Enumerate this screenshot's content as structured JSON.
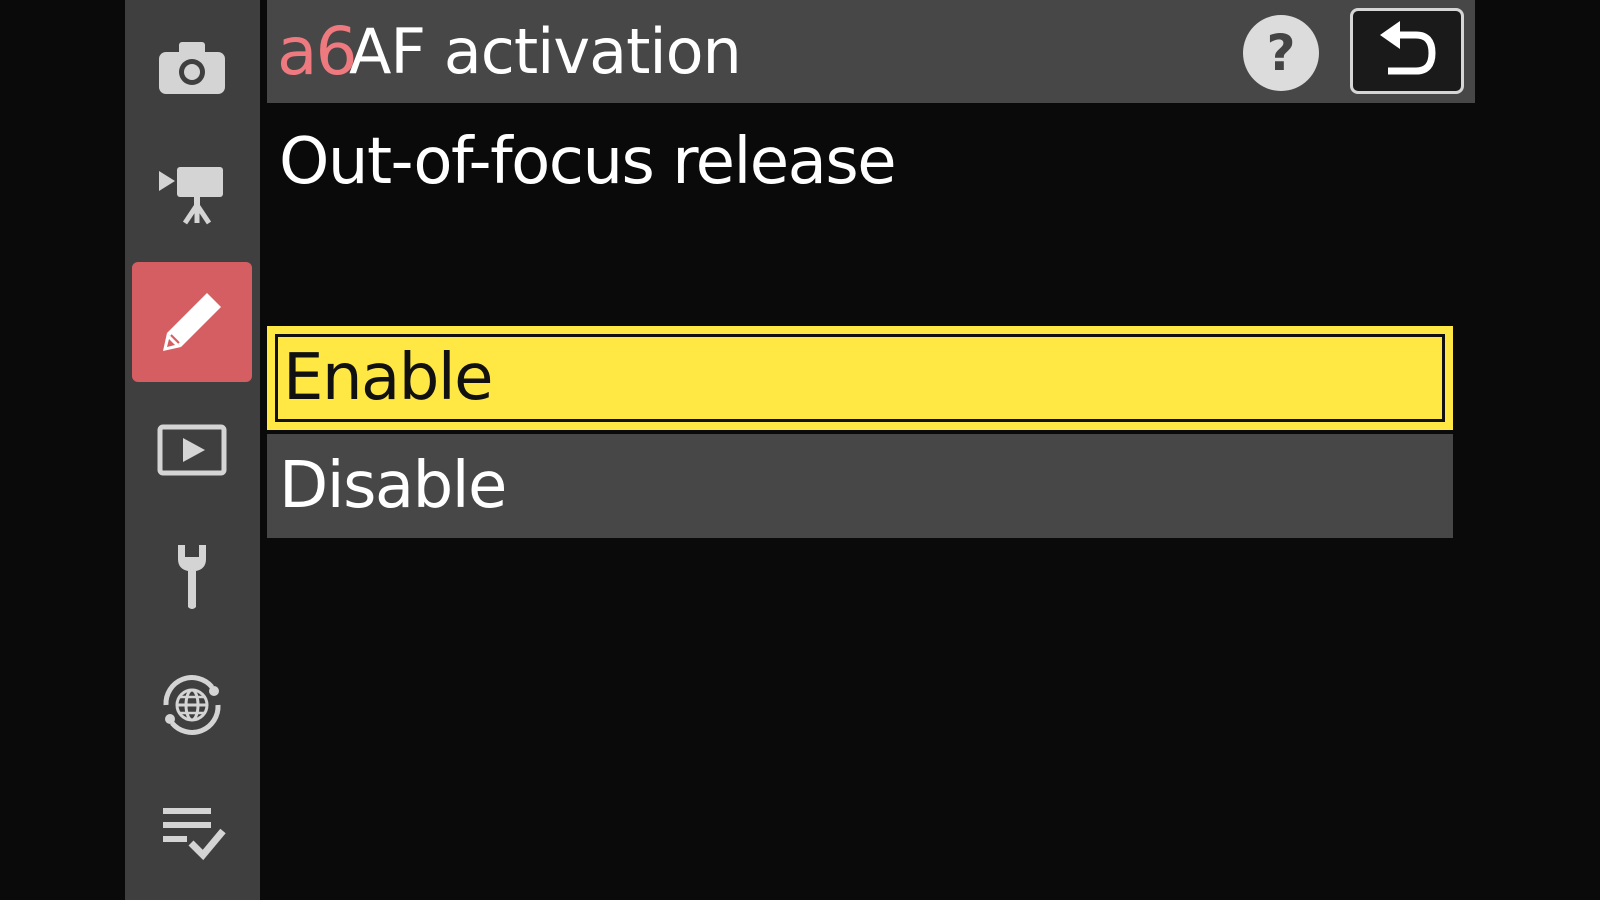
{
  "colors": {
    "accent": "#d55e63",
    "code_text": "#ee7a80",
    "selected_bg": "#ffe843",
    "bar_bg": "#474747",
    "sidebar_bg": "#3f3f3f",
    "screen_bg": "#0a0a0a"
  },
  "sidebar": {
    "items": [
      {
        "icon": "photo-shooting-menu-icon",
        "active": false
      },
      {
        "icon": "movie-recording-menu-icon",
        "active": false
      },
      {
        "icon": "custom-settings-menu-icon",
        "active": true
      },
      {
        "icon": "playback-menu-icon",
        "active": false
      },
      {
        "icon": "setup-menu-icon",
        "active": false
      },
      {
        "icon": "network-menu-icon",
        "active": false
      },
      {
        "icon": "my-menu-icon",
        "active": false
      }
    ]
  },
  "header": {
    "code": "a6",
    "title": "AF activation",
    "help_label": "?",
    "back_icon": "back-arrow-icon"
  },
  "subtitle": "Out-of-focus release",
  "options": [
    {
      "label": "Enable",
      "selected": true
    },
    {
      "label": "Disable",
      "selected": false
    }
  ]
}
